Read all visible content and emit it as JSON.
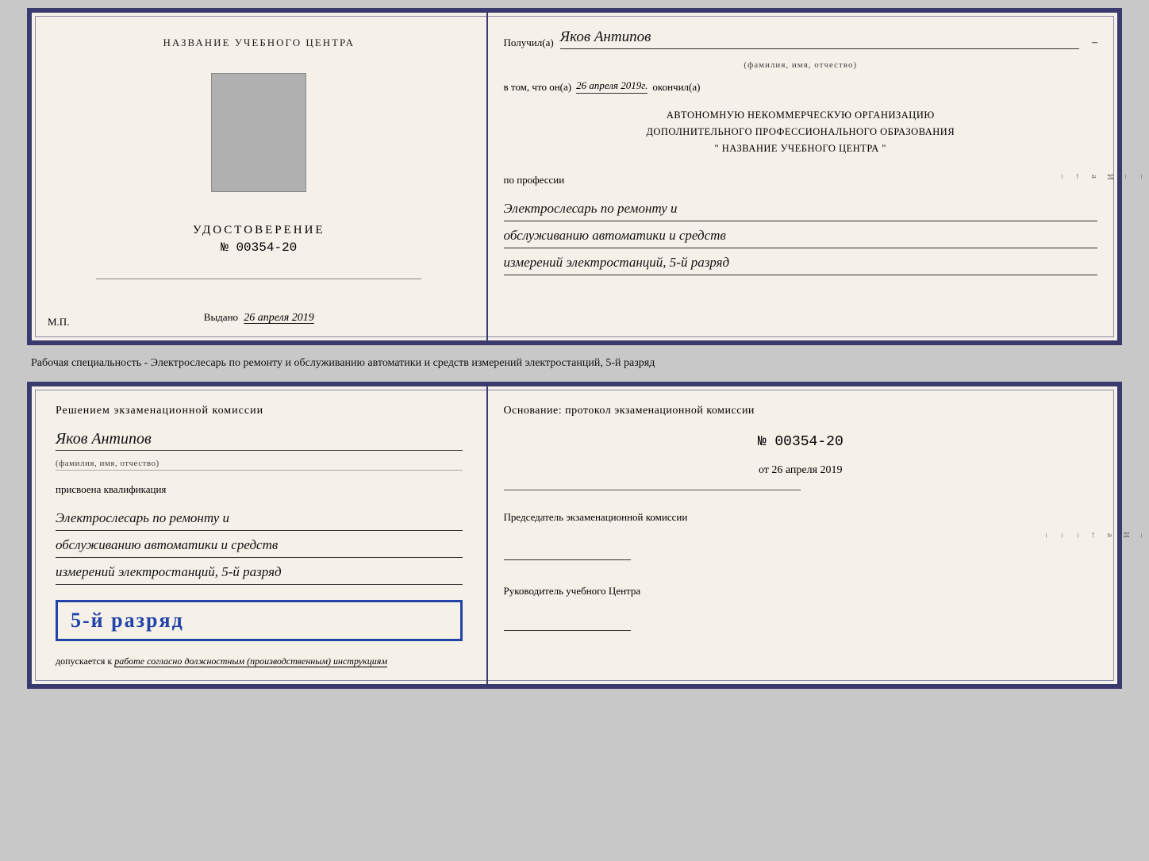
{
  "topDoc": {
    "left": {
      "title": "НАЗВАНИЕ УЧЕБНОГО ЦЕНТРА",
      "certLabel": "УДОСТОВЕРЕНИЕ",
      "certNumber": "№ 00354-20",
      "issuedPrefix": "Выдано",
      "issuedDate": "26 апреля 2019",
      "mpLabel": "М.П."
    },
    "right": {
      "recipientPrefix": "Получил(а)",
      "recipientName": "Яков Антипов",
      "recipientSub": "(фамилия, имя, отчество)",
      "confirmLine": "в том, что он(а)",
      "confirmDate": "26 апреля 2019г.",
      "confirmSuffix": "окончил(а)",
      "orgLine1": "АВТОНОМНУЮ НЕКОММЕРЧЕСКУЮ ОРГАНИЗАЦИЮ",
      "orgLine2": "ДОПОЛНИТЕЛЬНОГО ПРОФЕССИОНАЛЬНОГО ОБРАЗОВАНИЯ",
      "orgName": "\"  НАЗВАНИЕ УЧЕБНОГО ЦЕНТРА  \"",
      "profLabel": "по профессии",
      "profLine1": "Электрослесарь по ремонту и",
      "profLine2": "обслуживанию автоматики и средств",
      "profLine3": "измерений электростанций, 5-й разряд"
    }
  },
  "separatorText": "Рабочая специальность - Электрослесарь по ремонту и обслуживанию автоматики и средств измерений электростанций, 5-й разряд",
  "bottomDoc": {
    "left": {
      "decisionText": "Решением экзаменационной комиссии",
      "personName": "Яков Антипов",
      "personSub": "(фамилия, имя, отчество)",
      "qualLabel": "присвоена квалификация",
      "qualLine1": "Электрослесарь по ремонту и",
      "qualLine2": "обслуживанию автоматики и средств",
      "qualLine3": "измерений электростанций, 5-й разряд",
      "gradeBadge": "5-й разряд",
      "admittedText": "допускается к",
      "admittedItalic": "работе согласно должностным (производственным) инструкциям"
    },
    "right": {
      "basisLabel": "Основание: протокол экзаменационной комиссии",
      "protocolNumber": "№ 00354-20",
      "protocolDatePrefix": "от",
      "protocolDate": "26 апреля 2019",
      "chairmanLabel": "Председатель экзаменационной комиссии",
      "directorLabel": "Руководитель учебного Центра"
    }
  },
  "decoChars": {
    "right1": "И",
    "right2": "а",
    "right3": "←",
    "dashes": [
      "–",
      "–",
      "–",
      "–"
    ]
  }
}
